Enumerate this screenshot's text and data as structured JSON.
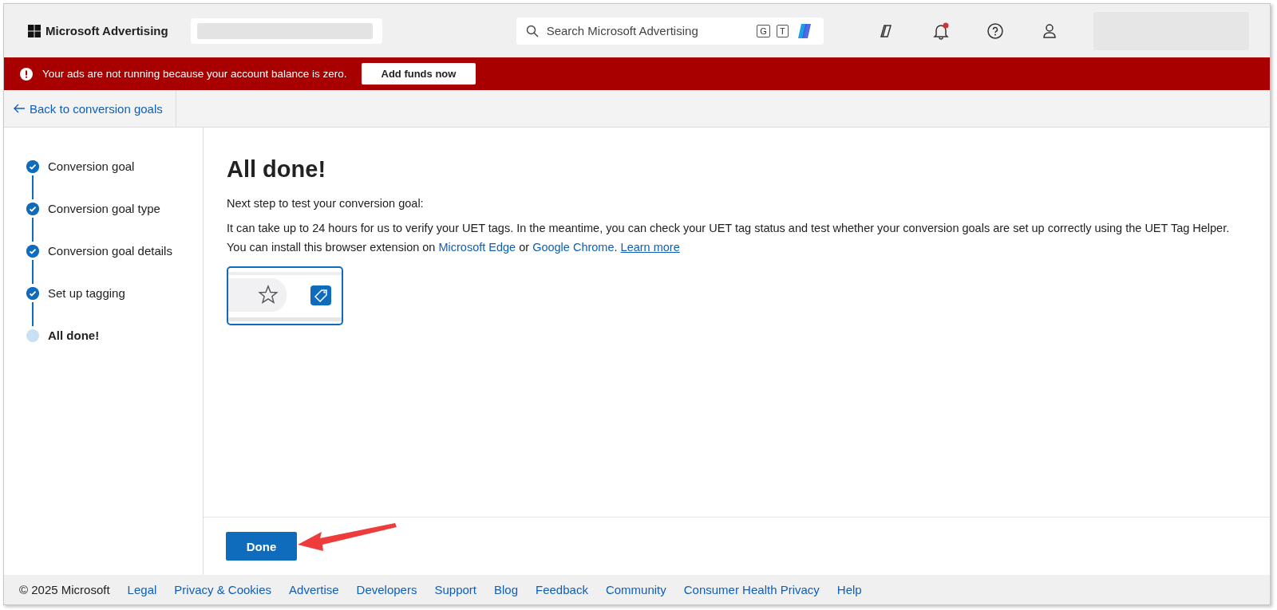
{
  "header": {
    "brand": "Microsoft Advertising",
    "search": {
      "placeholder": "Search Microsoft Advertising",
      "keys": [
        "G",
        "T"
      ]
    },
    "notification_badge": true
  },
  "alert": {
    "message": "Your ads are not running because your account balance is zero.",
    "button": "Add funds now"
  },
  "back_link": "Back to conversion goals",
  "steps": [
    {
      "label": "Conversion goal",
      "completed": true
    },
    {
      "label": "Conversion goal type",
      "completed": true
    },
    {
      "label": "Conversion goal details",
      "completed": true
    },
    {
      "label": "Set up tagging",
      "completed": true
    },
    {
      "label": "All done!",
      "completed": false
    }
  ],
  "content": {
    "title": "All done!",
    "intro": "Next step to test your conversion goal:",
    "paragraph": [
      {
        "kind": "text",
        "text": "It can take up to 24 hours for us to verify your UET tags. In the meantime, you can check your UET tag status and test whether your conversion goals are set up correctly using the UET Tag Helper. You can install this browser extension on "
      },
      {
        "kind": "link",
        "text": "Microsoft Edge"
      },
      {
        "kind": "text",
        "text": " or "
      },
      {
        "kind": "link",
        "text": "Google Chrome"
      },
      {
        "kind": "text",
        "text": ".  "
      },
      {
        "kind": "underlined_link",
        "text": "Learn more"
      }
    ]
  },
  "done_button": "Done",
  "footer": {
    "copyright": "© 2025 Microsoft",
    "links": [
      "Legal",
      "Privacy & Cookies",
      "Advertise",
      "Developers",
      "Support",
      "Blog",
      "Feedback",
      "Community",
      "Consumer Health Privacy",
      "Help"
    ]
  }
}
